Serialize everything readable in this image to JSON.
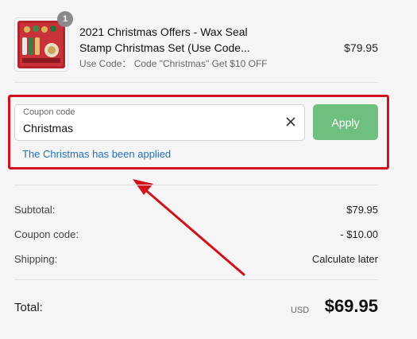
{
  "product": {
    "quantity": "1",
    "title": "2021 Christmas Offers - Wax Seal Stamp Christmas Set (Use Code...",
    "code_note": "Use Code： Code \"Christmas\" Get $10 OFF",
    "price": "$79.95"
  },
  "coupon": {
    "label": "Coupon code",
    "value": "Christmas",
    "apply_label": "Apply",
    "applied_message": "The Christmas has been applied"
  },
  "summary": {
    "rows": [
      {
        "label": "Subtotal:",
        "value": "$79.95"
      },
      {
        "label": "Coupon code:",
        "value": "- $10.00"
      },
      {
        "label": "Shipping:",
        "value": "Calculate later"
      }
    ],
    "total_label": "Total:",
    "currency": "USD",
    "total_value": "$69.95"
  },
  "colors": {
    "apply_button": "#6fbf7f",
    "highlight_box": "#d1121c",
    "applied_text": "#1f6fbf"
  }
}
